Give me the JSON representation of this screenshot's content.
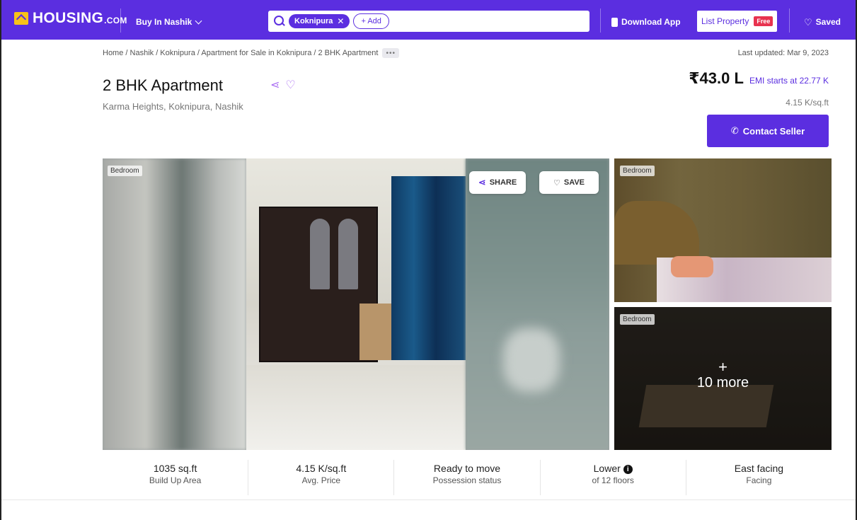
{
  "header": {
    "logo": "HOUSING",
    "logo_suffix": ".COM",
    "city_selector": "Buy In Nashik",
    "search_chip": "Koknipura",
    "add_chip": "+ Add",
    "download_app": "Download App",
    "list_property": "List Property",
    "free_badge": "Free",
    "saved": "Saved"
  },
  "breadcrumb": {
    "path": "Home / Nashik / Koknipura / Apartment for Sale in Koknipura / 2 BHK Apartment",
    "more": "•••"
  },
  "last_updated": "Last updated: Mar 9, 2023",
  "listing": {
    "title": "2 BHK Apartment",
    "location": "Karma Heights, Koknipura, Nashik",
    "price": "₹43.0 L",
    "emi": "EMI starts at  22.77 K",
    "price_per_sqft": "4.15 K/sq.ft",
    "contact_button": "Contact Seller"
  },
  "gallery": {
    "main_tag": "Bedroom",
    "share_label": "SHARE",
    "save_label": "SAVE",
    "thumb1_tag": "Bedroom",
    "thumb2_tag": "Bedroom",
    "more_plus": "+",
    "more_label": "10 more"
  },
  "stats": [
    {
      "value": "1035 sq.ft",
      "label": "Build Up Area"
    },
    {
      "value": "4.15 K/sq.ft",
      "label": "Avg. Price"
    },
    {
      "value": "Ready to move",
      "label": "Possession status"
    },
    {
      "value": "Lower",
      "label": "of 12 floors"
    },
    {
      "value": "East facing",
      "label": "Facing"
    }
  ],
  "colors": {
    "brand": "#5b2ee0",
    "logo_accent": "#f7c21a",
    "free_badge": "#e8334f"
  }
}
